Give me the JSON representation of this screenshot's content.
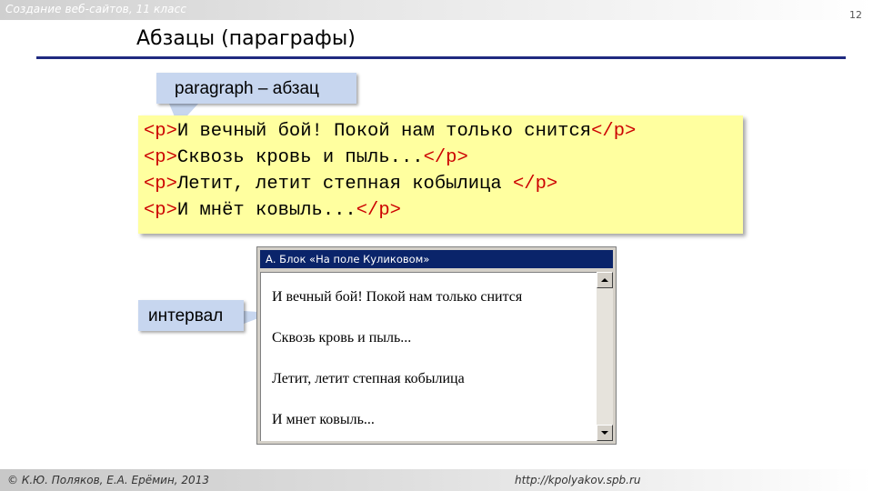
{
  "header": {
    "course": "Создание веб-сайтов, 11 класс",
    "slide_number": "12"
  },
  "title": "Абзацы (параграфы)",
  "callouts": {
    "paragraph": "paragraph – абзац",
    "interval": "интервал"
  },
  "code": {
    "open_tag": "<p>",
    "close_tag": "</p>",
    "lines": [
      "И вечный бой! Покой нам только снится",
      "Сквозь кровь и пыль...",
      "Летит, летит степная кобылица ",
      "И мнёт ковыль..."
    ]
  },
  "browser": {
    "window_title": "А. Блок «На поле Куликовом»",
    "paragraphs": [
      "И вечный бой! Покой нам только снится",
      "Сквозь кровь и пыль...",
      "Летит, летит степная кобылица",
      "И мнет ковыль..."
    ]
  },
  "footer": {
    "authors": "© К.Ю. Поляков, Е.А. Ерёмин, 2013",
    "url": "http://kpolyakov.spb.ru"
  },
  "colors": {
    "title_rule": "#1f2a80",
    "callout_bg": "#c7d6ef",
    "code_bg": "#ffff9f",
    "tag_color": "#cc0000",
    "window_title_bg": "#0a246a"
  }
}
